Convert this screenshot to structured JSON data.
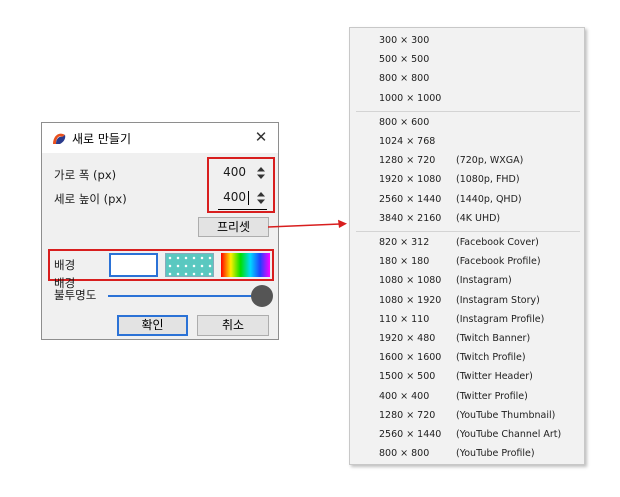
{
  "dialog": {
    "title": "새로 만들기",
    "close_glyph": "✕",
    "width_label": "가로 폭 (px)",
    "width_value": "400",
    "height_label": "세로 높이 (px)",
    "height_value": "400",
    "preset_button": "프리셋",
    "background_label": "배경",
    "opacity_label_line1": "배경",
    "opacity_label_line2": "불투명도",
    "opacity_value": 1.0,
    "ok_button": "확인",
    "cancel_button": "취소",
    "icons": {
      "app": "app-logo-icon",
      "spinner": "spinner-updown-icon"
    },
    "colors": {
      "highlight": "#d81e1e",
      "accent": "#2b72d6",
      "dots_swatch": "#5ac8c0"
    }
  },
  "menu": {
    "groups": [
      [
        {
          "size": "300 × 300",
          "desc": ""
        },
        {
          "size": "500 × 500",
          "desc": ""
        },
        {
          "size": "800 × 800",
          "desc": ""
        },
        {
          "size": "1000 × 1000",
          "desc": ""
        }
      ],
      [
        {
          "size": "800 × 600",
          "desc": ""
        },
        {
          "size": "1024 × 768",
          "desc": ""
        },
        {
          "size": "1280 × 720",
          "desc": "(720p, WXGA)"
        },
        {
          "size": "1920 × 1080",
          "desc": "(1080p, FHD)"
        },
        {
          "size": "2560 × 1440",
          "desc": "(1440p, QHD)"
        },
        {
          "size": "3840 × 2160",
          "desc": "(4K UHD)"
        }
      ],
      [
        {
          "size": "820 × 312",
          "desc": "(Facebook Cover)"
        },
        {
          "size": "180 × 180",
          "desc": "(Facebook Profile)"
        },
        {
          "size": "1080 × 1080",
          "desc": "(Instagram)"
        },
        {
          "size": "1080 × 1920",
          "desc": "(Instagram Story)"
        },
        {
          "size": "110 × 110",
          "desc": "(Instagram Profile)"
        },
        {
          "size": "1920 × 480",
          "desc": "(Twitch Banner)"
        },
        {
          "size": "1600 × 1600",
          "desc": "(Twitch Profile)"
        },
        {
          "size": "1500 × 500",
          "desc": "(Twitter Header)"
        },
        {
          "size": "400 × 400",
          "desc": "(Twitter Profile)"
        },
        {
          "size": "1280 × 720",
          "desc": "(YouTube Thumbnail)"
        },
        {
          "size": "2560 × 1440",
          "desc": "(YouTube Channel Art)"
        },
        {
          "size": "800 × 800",
          "desc": "(YouTube Profile)"
        }
      ]
    ]
  }
}
